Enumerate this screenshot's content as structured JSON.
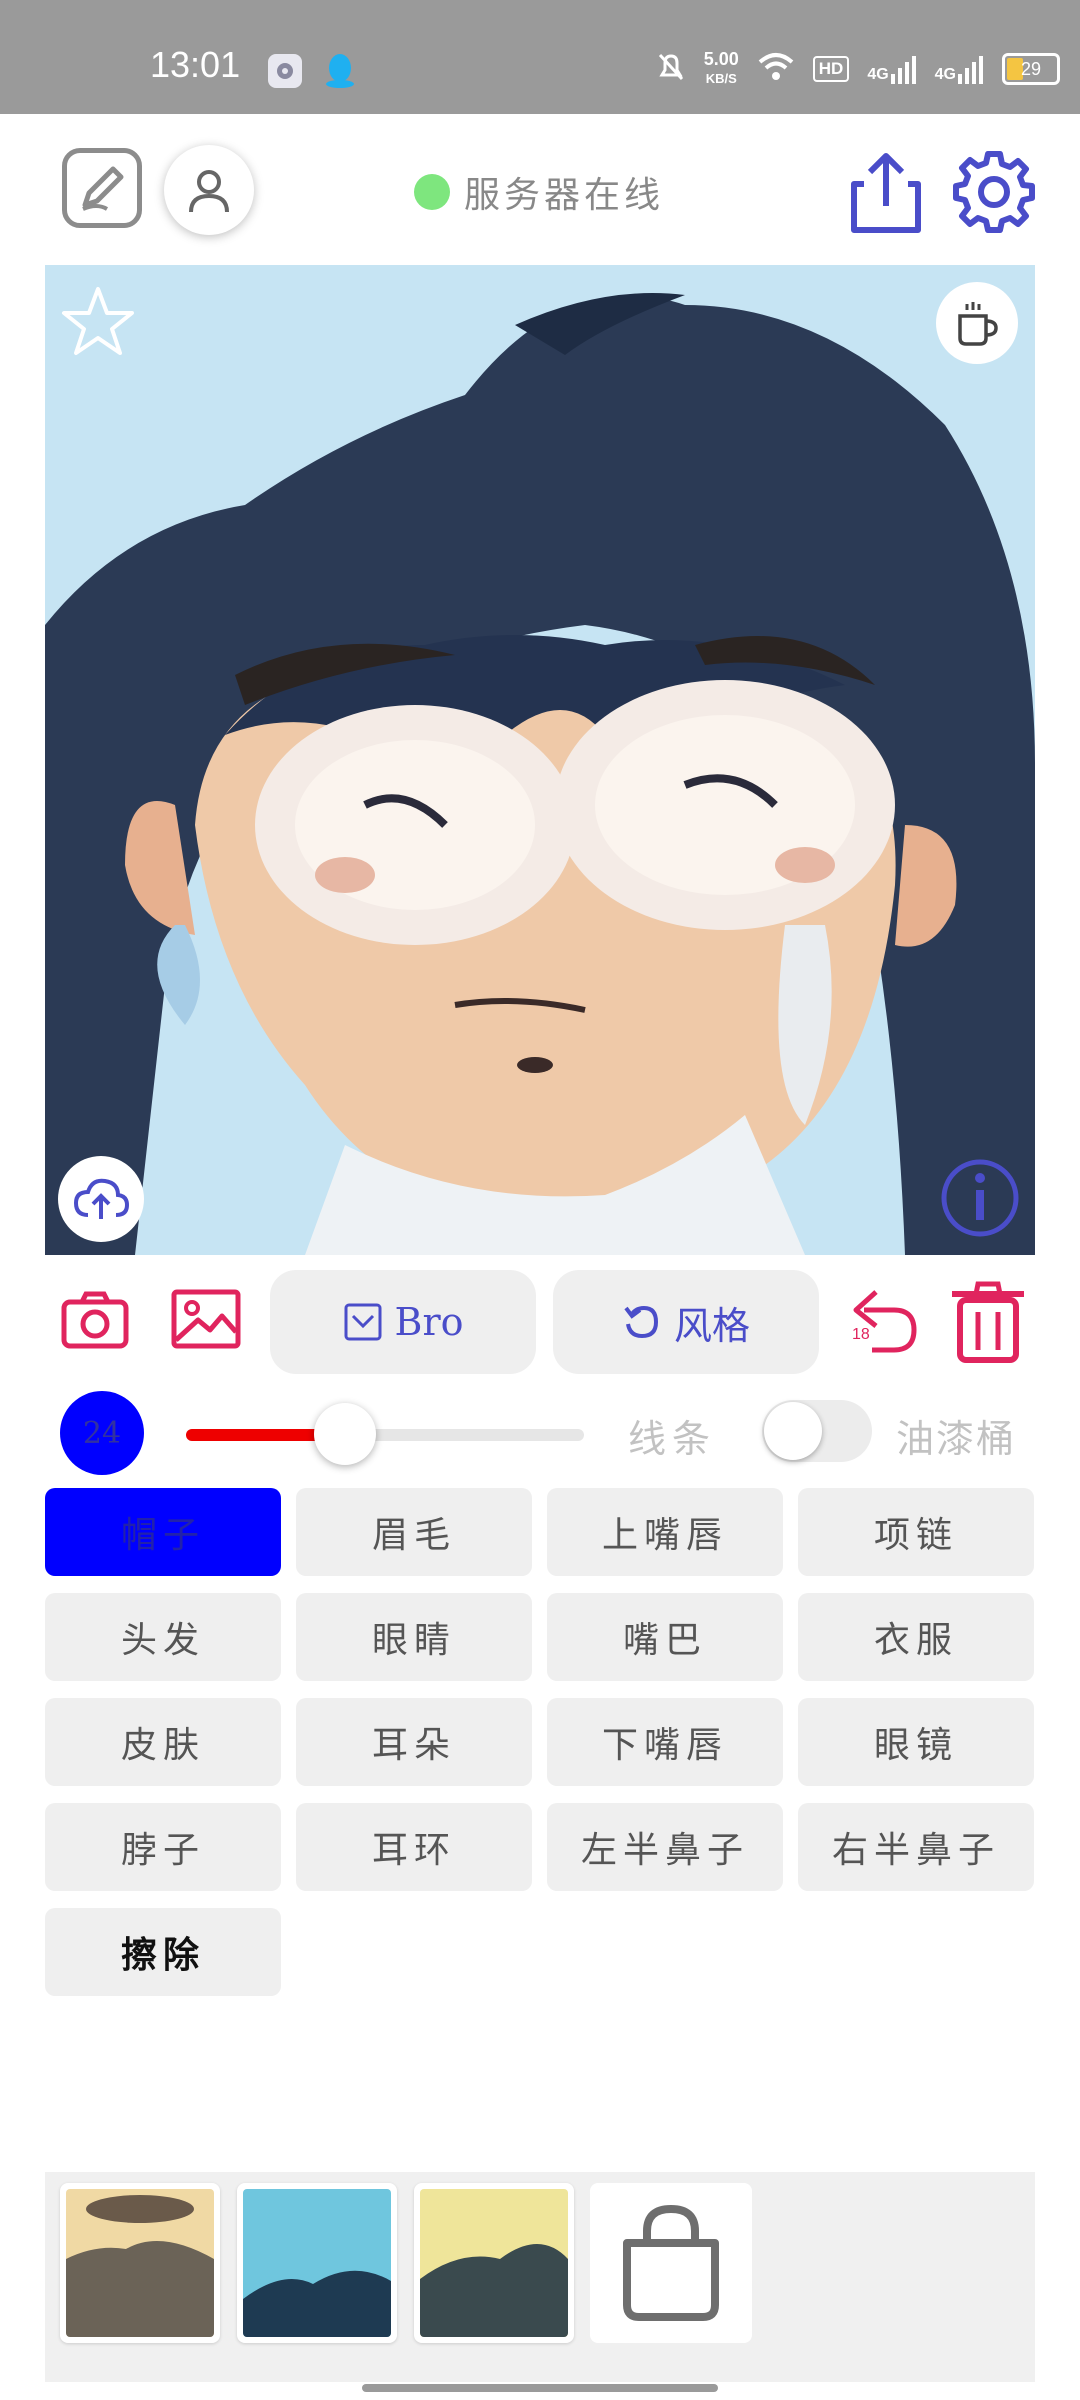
{
  "status_bar": {
    "time": "13:01",
    "speed_value": "5.00",
    "speed_unit": "KB/S",
    "hd": "HD",
    "net1": "4G",
    "net2": "4G",
    "battery": "29",
    "icons": [
      "settings-notification-icon",
      "qq-icon",
      "mute-icon",
      "wifi-icon",
      "signal-icon",
      "battery-icon"
    ]
  },
  "header": {
    "server_status": "服务器在线",
    "status_color": "#7ee67e",
    "icons": [
      "edit-icon",
      "user-icon",
      "share-icon",
      "gear-icon"
    ]
  },
  "canvas": {
    "icons": [
      "star-icon",
      "coffee-cup-icon",
      "cloud-upload-icon",
      "info-icon"
    ]
  },
  "toolbar": {
    "bro_label": "Bro",
    "style_label": "风格",
    "undo_count": "18",
    "icons": [
      "camera-icon",
      "image-icon",
      "checkbox-icon",
      "refresh-icon",
      "undo-icon",
      "trash-icon"
    ],
    "accent": "#e0245e",
    "primary": "#4a4dc9"
  },
  "brush": {
    "size": "24",
    "slider_value_fraction": 0.4,
    "lines_label": "线条",
    "bucket_label": "油漆桶",
    "bucket_enabled": false
  },
  "parts": [
    {
      "label": "帽子"
    },
    {
      "label": "眉毛"
    },
    {
      "label": "上嘴唇"
    },
    {
      "label": "项链"
    },
    {
      "label": "头发"
    },
    {
      "label": "眼睛"
    },
    {
      "label": "嘴巴"
    },
    {
      "label": "衣服"
    },
    {
      "label": "皮肤"
    },
    {
      "label": "耳朵"
    },
    {
      "label": "下嘴唇"
    },
    {
      "label": "眼镜"
    },
    {
      "label": "脖子"
    },
    {
      "label": "耳环"
    },
    {
      "label": "左半鼻子"
    },
    {
      "label": "右半鼻子"
    },
    {
      "label": "擦除"
    }
  ],
  "selected_part": "帽子",
  "tray": {
    "icons": [
      "shopping-bag-icon"
    ]
  }
}
